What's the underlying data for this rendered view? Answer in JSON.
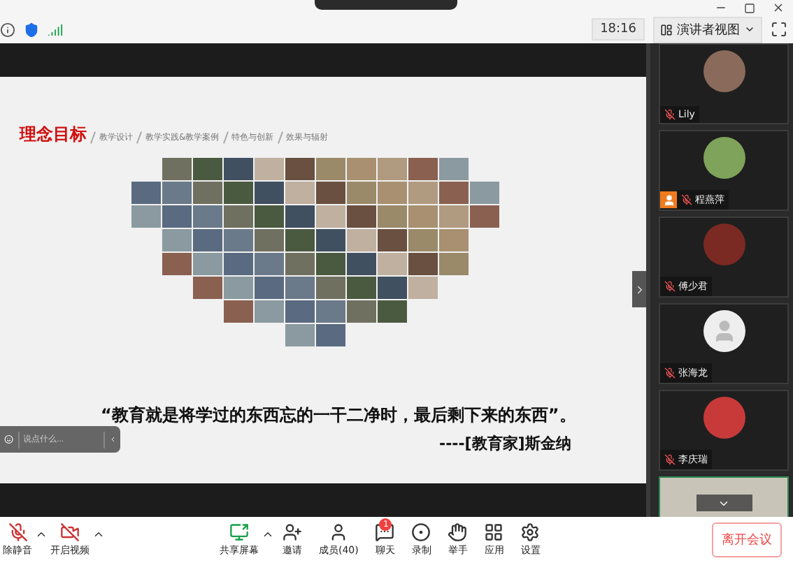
{
  "top_bar": {
    "time": "18:16",
    "view_mode": "演讲者视图"
  },
  "slide": {
    "title": "理念目标",
    "nav": [
      "教学设计",
      "教学实践&教学案例",
      "特色与创新",
      "效果与辐射"
    ],
    "quote": "“教育就是将学过的东西忘的一干二净时，最后剩下来的东西”。",
    "attribution": "----[教育家]斯金纳"
  },
  "chat_input": {
    "placeholder": "说点什么..."
  },
  "participants": [
    {
      "kind": "photo",
      "name": "Lily",
      "host": false,
      "color": "#8a6a5a"
    },
    {
      "kind": "photo",
      "name": "程燕萍",
      "host": true,
      "color": "#7fa35a"
    },
    {
      "kind": "photo",
      "name": "傅少君",
      "host": false,
      "color": "#7a2a22"
    },
    {
      "kind": "default",
      "name": "张海龙",
      "host": false
    },
    {
      "kind": "photo",
      "name": "李庆瑞",
      "host": false,
      "color": "#c83a3a"
    },
    {
      "kind": "video"
    }
  ],
  "toolbar": {
    "left": [
      {
        "kind": "mic",
        "label": "除静音",
        "caret": true
      },
      {
        "kind": "camera",
        "label": "开启视频",
        "caret": true
      }
    ],
    "center": [
      {
        "kind": "share",
        "label": "共享屏幕",
        "caret": true
      },
      {
        "kind": "invite",
        "label": "邀请",
        "caret": false
      },
      {
        "kind": "members",
        "label": "成员(40)",
        "caret": false
      },
      {
        "kind": "chat",
        "label": "聊天",
        "caret": false,
        "badge": "1"
      },
      {
        "kind": "record",
        "label": "录制",
        "caret": false
      },
      {
        "kind": "hand",
        "label": "举手",
        "caret": false
      },
      {
        "kind": "apps",
        "label": "应用",
        "caret": false
      },
      {
        "kind": "settings",
        "label": "设置",
        "caret": false
      }
    ],
    "leave": "离开会议"
  }
}
